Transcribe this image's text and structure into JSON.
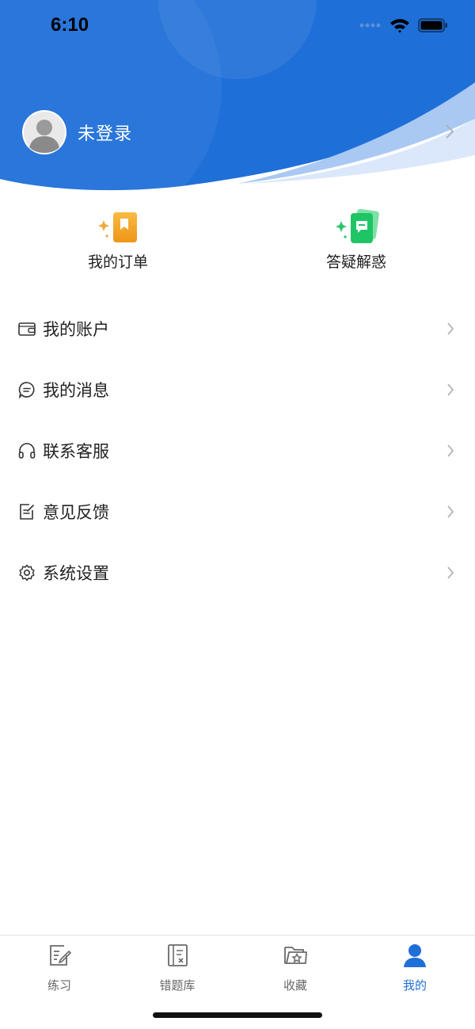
{
  "status_bar": {
    "time": "6:10"
  },
  "profile": {
    "name": "未登录"
  },
  "quick_actions": [
    {
      "label": "我的订单",
      "icon": "bookmark-book-icon"
    },
    {
      "label": "答疑解惑",
      "icon": "chat-cards-icon"
    }
  ],
  "menu": [
    {
      "label": "我的账户",
      "icon": "wallet-icon"
    },
    {
      "label": "我的消息",
      "icon": "message-icon"
    },
    {
      "label": "联系客服",
      "icon": "headphones-icon"
    },
    {
      "label": "意见反馈",
      "icon": "feedback-edit-icon"
    },
    {
      "label": "系统设置",
      "icon": "gear-icon"
    }
  ],
  "tabbar": [
    {
      "label": "练习",
      "icon": "practice-edit-icon",
      "active": false
    },
    {
      "label": "错题库",
      "icon": "error-book-icon",
      "active": false
    },
    {
      "label": "收藏",
      "icon": "star-folder-icon",
      "active": false
    },
    {
      "label": "我的",
      "icon": "user-icon",
      "active": true
    }
  ],
  "colors": {
    "primary": "#1f6fd8",
    "header_light": "#a8c8f2",
    "text": "#222222",
    "muted": "#666666"
  }
}
